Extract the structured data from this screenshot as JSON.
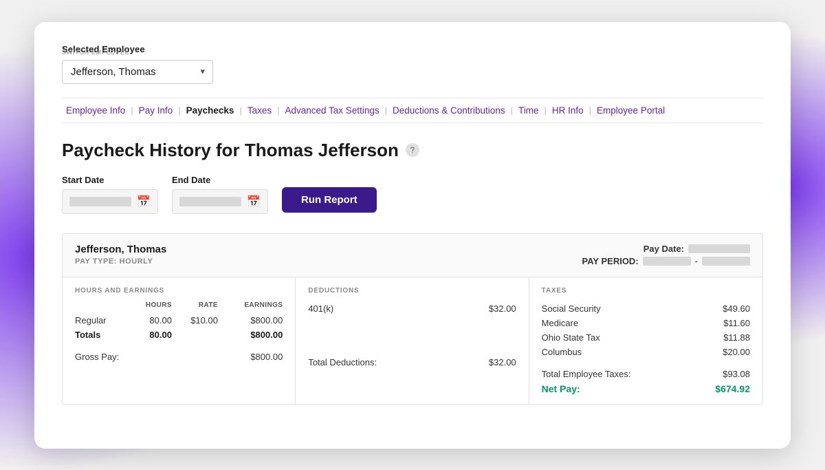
{
  "background": {},
  "card": {
    "selected_employee_label": "Selected Employee",
    "switch_label": "SWITCH EMPLOYEE",
    "employee_name": "Jefferson, Thomas",
    "nav": {
      "items": [
        {
          "label": "Employee Info",
          "active": false
        },
        {
          "label": "Pay Info",
          "active": false
        },
        {
          "label": "Paychecks",
          "active": true
        },
        {
          "label": "Taxes",
          "active": false
        },
        {
          "label": "Advanced Tax Settings",
          "active": false
        },
        {
          "label": "Deductions & Contributions",
          "active": false
        },
        {
          "label": "Time",
          "active": false
        },
        {
          "label": "HR Info",
          "active": false
        },
        {
          "label": "Employee Portal",
          "active": false
        }
      ]
    },
    "page_title": "Paycheck History for Thomas Jefferson",
    "start_date_label": "Start Date",
    "end_date_label": "End Date",
    "run_report_label": "Run Report",
    "paycheck": {
      "employee": "Jefferson, Thomas",
      "pay_type": "PAY TYPE: HOURLY",
      "pay_date_label": "Pay Date:",
      "pay_period_label": "PAY PERIOD:",
      "pay_period_dash": "-",
      "hours_earnings": {
        "section_label": "HOURS AND EARNINGS",
        "col_hours": "HOURS",
        "col_rate": "RATE",
        "col_earnings": "EARNINGS",
        "rows": [
          {
            "label": "Regular",
            "hours": "80.00",
            "rate": "$10.00",
            "earnings": "$800.00"
          }
        ],
        "totals_label": "Totals",
        "totals_hours": "80.00",
        "totals_earnings": "$800.00",
        "gross_pay_label": "Gross Pay:",
        "gross_pay_value": "$800.00"
      },
      "deductions": {
        "section_label": "DEDUCTIONS",
        "rows": [
          {
            "label": "401(k)",
            "value": "$32.00"
          }
        ],
        "total_label": "Total Deductions:",
        "total_value": "$32.00"
      },
      "taxes": {
        "section_label": "TAXES",
        "rows": [
          {
            "label": "Social Security",
            "value": "$49.60"
          },
          {
            "label": "Medicare",
            "value": "$11.60"
          },
          {
            "label": "Ohio State Tax",
            "value": "$11.88"
          },
          {
            "label": "Columbus",
            "value": "$20.00"
          }
        ],
        "total_label": "Total Employee Taxes:",
        "total_value": "$93.08",
        "net_pay_label": "Net Pay:",
        "net_pay_value": "$674.92"
      }
    }
  }
}
